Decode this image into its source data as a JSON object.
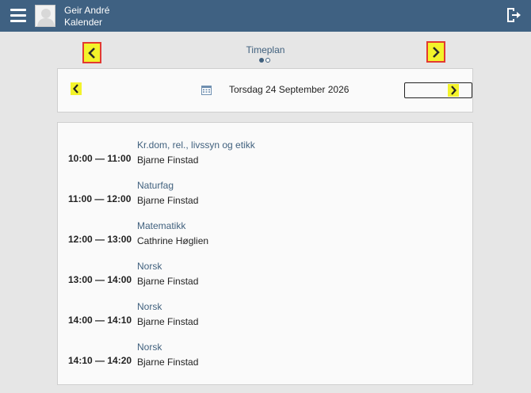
{
  "header": {
    "user_name": "Geir André",
    "section": "Kalender"
  },
  "timeplan": {
    "title": "Timeplan",
    "pages": 2,
    "active_page": 1
  },
  "date_nav": {
    "date": "Torsdag 24 September 2026"
  },
  "schedule": [
    {
      "time": "10:00 — 11:00",
      "subject": "Kr.dom, rel., livssyn og etikk",
      "teacher": "Bjarne Finstad"
    },
    {
      "time": "11:00 — 12:00",
      "subject": "Naturfag",
      "teacher": "Bjarne Finstad"
    },
    {
      "time": "12:00 — 13:00",
      "subject": "Matematikk",
      "teacher": "Cathrine Høglien"
    },
    {
      "time": "13:00 — 14:00",
      "subject": "Norsk",
      "teacher": "Bjarne Finstad"
    },
    {
      "time": "14:00 — 14:10",
      "subject": "Norsk",
      "teacher": "Bjarne Finstad"
    },
    {
      "time": "14:10 — 14:20",
      "subject": "Norsk",
      "teacher": "Bjarne Finstad"
    }
  ],
  "colors": {
    "header_bg": "#3f6182",
    "link": "#41617e",
    "highlight": "#f3f32a",
    "outline": "#e23a32"
  },
  "icons": {
    "menu": "hamburger-menu-icon",
    "avatar": "user-silhouette-icon",
    "logout": "logout-door-icon",
    "prev": "chevron-left-icon",
    "next": "chevron-right-icon",
    "calendar": "calendar-icon"
  }
}
